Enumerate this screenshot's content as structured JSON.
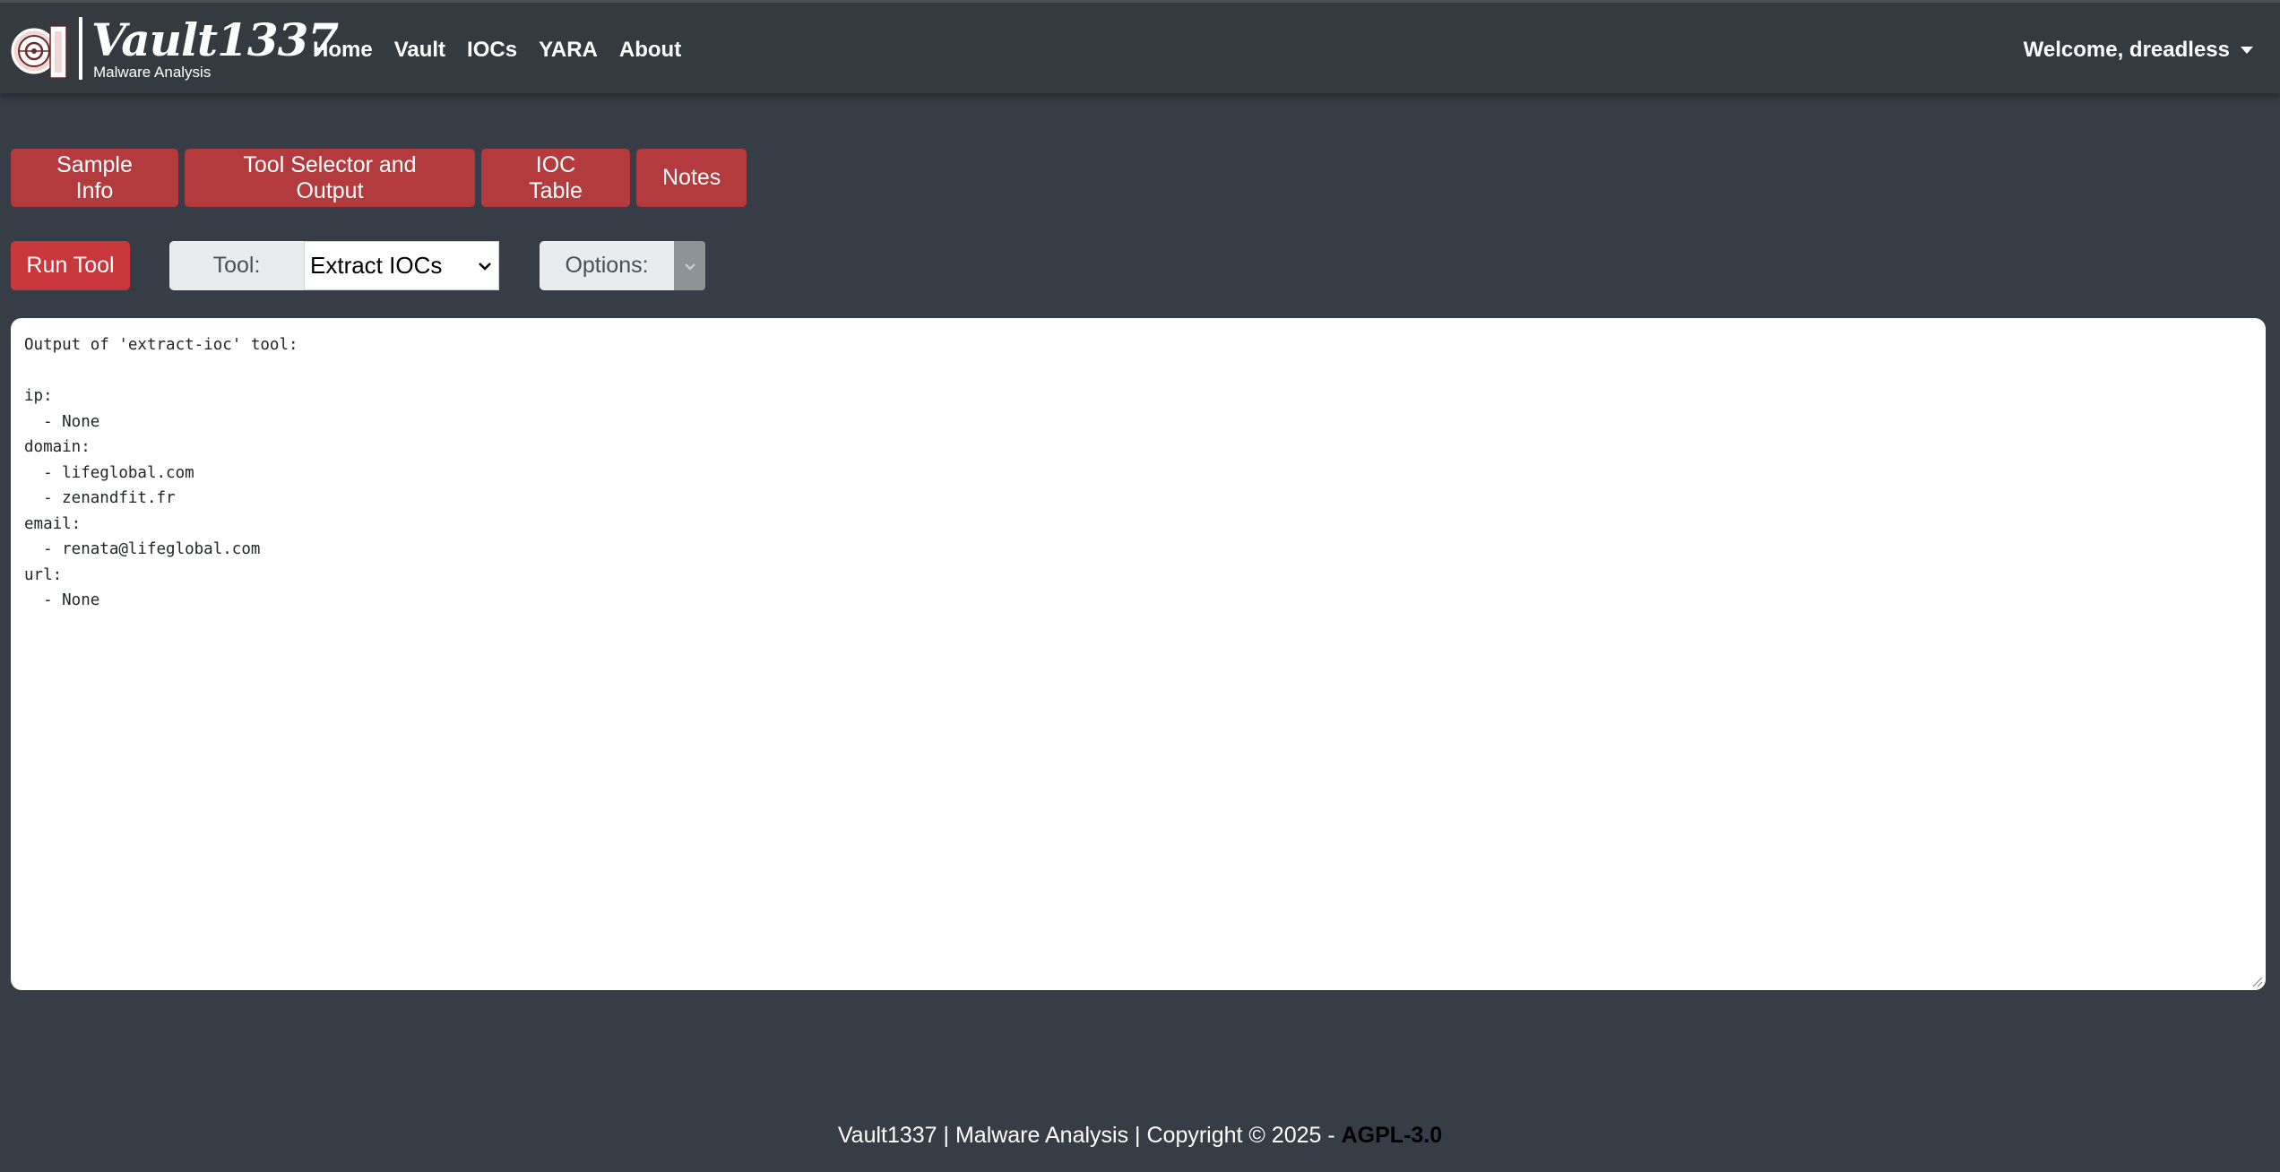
{
  "brand": {
    "name": "Vault1337",
    "subtitle": "Malware Analysis"
  },
  "nav": {
    "items": [
      {
        "label": "Home"
      },
      {
        "label": "Vault"
      },
      {
        "label": "IOCs"
      },
      {
        "label": "YARA"
      },
      {
        "label": "About"
      }
    ]
  },
  "user": {
    "welcome": "Welcome, dreadless"
  },
  "tabs": [
    {
      "label": "Sample Info"
    },
    {
      "label": "Tool Selector and Output"
    },
    {
      "label": "IOC Table"
    },
    {
      "label": "Notes"
    }
  ],
  "tool_bar": {
    "run_label": "Run Tool",
    "tool_label": "Tool:",
    "tool_selected": "Extract IOCs",
    "options_label": "Options:"
  },
  "output": {
    "text": "Output of 'extract-ioc' tool:\n\nip:\n  - None\ndomain:\n  - lifeglobal.com\n  - zenandfit.fr\nemail:\n  - renata@lifeglobal.com\nurl:\n  - None"
  },
  "footer": {
    "text": "Vault1337 | Malware Analysis | Copyright © 2025 - ",
    "license": "AGPL-3.0"
  },
  "colors": {
    "background": "#363d46",
    "navbar": "#343a40",
    "tab_button": "#b33b3d",
    "run_button": "#c8373b",
    "input_addon": "#e9ecef"
  }
}
